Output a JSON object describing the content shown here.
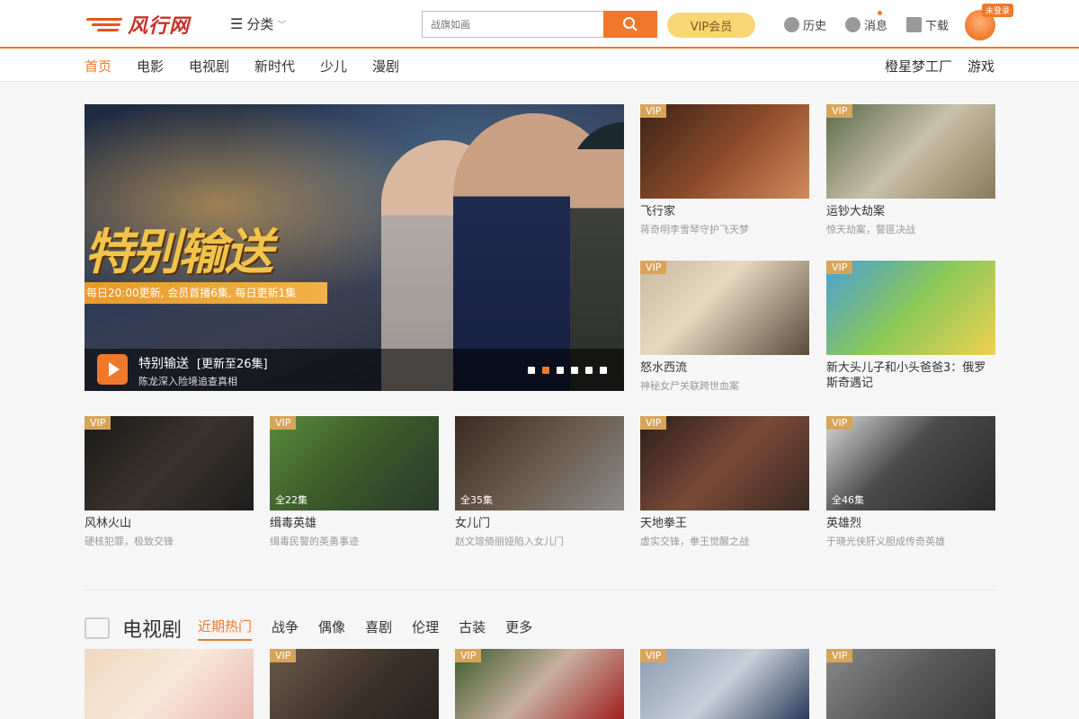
{
  "brand": {
    "name": "风行网",
    "accent": "#f0782a"
  },
  "header": {
    "category": "分类",
    "search_placeholder": "战旗如画",
    "vip": "VIP会员",
    "history": "历史",
    "messages": "消息",
    "download": "下载",
    "login_badge": "未登录"
  },
  "nav": {
    "items": [
      "首页",
      "电影",
      "电视剧",
      "新时代",
      "少儿",
      "漫剧"
    ],
    "right": [
      "橙星梦工厂",
      "游戏"
    ]
  },
  "hero": {
    "title": "特别输送",
    "ribbon": "每日20:00更新, 会员首播6集, 每日更新1集",
    "show": "特别输送",
    "status": "[更新至26集]",
    "desc": "陈龙深入险境追查真相"
  },
  "side": [
    {
      "title": "飞行家",
      "sub": "蒋奇明李雪琴守护飞天梦",
      "badge": "VIP"
    },
    {
      "title": "运钞大劫案",
      "sub": "惊天劫案，警匪决战",
      "badge": "VIP"
    },
    {
      "title": "怒水西流",
      "sub": "神秘女尸关联跨世血案",
      "badge": "VIP"
    },
    {
      "title": "新大头儿子和小头爸爸3：俄罗斯奇遇记",
      "sub": "",
      "badge": "VIP"
    }
  ],
  "row": [
    {
      "title": "风林火山",
      "sub": "硬核犯罪，极致交锋",
      "badge": "VIP",
      "ep": ""
    },
    {
      "title": "缉毒英雄",
      "sub": "缉毒民警的英勇事迹",
      "badge": "VIP",
      "ep": "全22集"
    },
    {
      "title": "女儿门",
      "sub": "赵文瑄倚丽娅陷入女儿门",
      "badge": "",
      "ep": "全35集"
    },
    {
      "title": "天地拳王",
      "sub": "虚实交锋，拳王觉醒之战",
      "badge": "VIP",
      "ep": ""
    },
    {
      "title": "英雄烈",
      "sub": "于晓光侠肝义胆成传奇英雄",
      "badge": "VIP",
      "ep": "全46集"
    }
  ],
  "tv": {
    "title": "电视剧",
    "tabs": [
      "近期热门",
      "战争",
      "偶像",
      "喜剧",
      "伦理",
      "古装",
      "更多"
    ]
  },
  "bottom": [
    {
      "badge": ""
    },
    {
      "badge": "VIP"
    },
    {
      "badge": "VIP"
    },
    {
      "badge": "VIP"
    },
    {
      "badge": "VIP"
    }
  ]
}
